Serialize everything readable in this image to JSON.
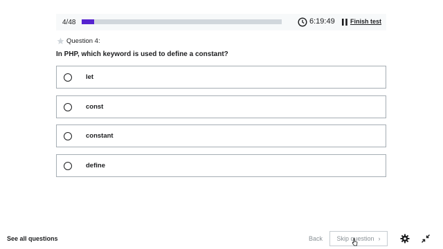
{
  "progress": {
    "count": "4/48",
    "fraction": 0.0625,
    "fill_color": "#5624d0"
  },
  "timer": {
    "value": "6:19:49",
    "icon": "clock-icon"
  },
  "controls": {
    "pause_icon": "pause-icon",
    "finish_label": "Finish test"
  },
  "question": {
    "number_label": "Question 4:",
    "star_icon": "star-icon",
    "text": "In PHP, which keyword is used to define a constant?"
  },
  "options": [
    {
      "label": "let"
    },
    {
      "label": "const"
    },
    {
      "label": "constant"
    },
    {
      "label": "define"
    }
  ],
  "footer": {
    "see_all": "See all questions",
    "back": "Back",
    "skip": "Skip question",
    "skip_chevron": "›",
    "settings_icon": "gear-icon",
    "collapse_icon": "collapse-icon"
  }
}
